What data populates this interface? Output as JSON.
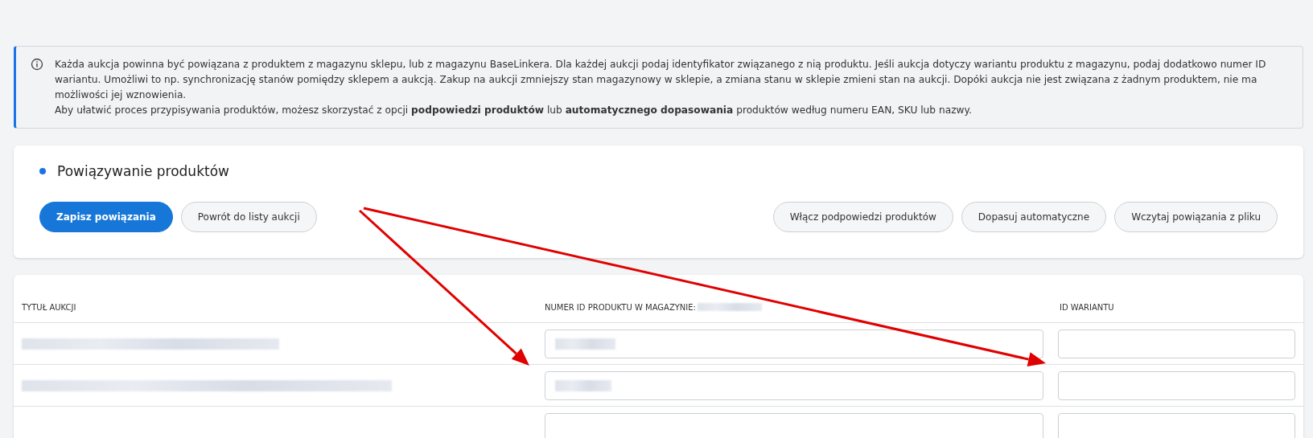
{
  "info": {
    "paragraphs": [
      "Każda aukcja powinna być powiązana z produktem z magazynu sklepu, lub z magazynu BaseLinkera. Dla każdej aukcji podaj identyfikator związanego z nią produktu. Jeśli aukcja dotyczy wariantu produktu z magazynu, podaj dodatkowo numer ID wariantu. Umożliwi to np. synchronizację stanów pomiędzy sklepem a aukcją. Zakup na aukcji zmniejszy stan magazynowy w sklepie, a zmiana stanu w sklepie zmieni stan na aukcji. Dopóki aukcja nie jest związana z żadnym produktem, nie ma możliwości jej wznowienia.",
      "Aby ułatwić proces przypisywania produktów, możesz skorzystać z opcji **podpowiedzi produktów** lub **automatycznego dopasowania** produktów według numeru EAN, SKU lub nazwy."
    ]
  },
  "section": {
    "title": "Powiązywanie produktów",
    "buttons_left": [
      {
        "label": "Zapisz powiązania",
        "kind": "primary"
      },
      {
        "label": "Powrót do listy aukcji",
        "kind": "secondary"
      }
    ],
    "buttons_right": [
      {
        "label": "Włącz podpowiedzi produktów",
        "kind": "secondary"
      },
      {
        "label": "Dopasuj automatyczne",
        "kind": "secondary"
      },
      {
        "label": "Wczytaj powiązania z pliku",
        "kind": "secondary"
      }
    ]
  },
  "table": {
    "columns": [
      "TYTUŁ AUKCJI",
      "NUMER ID PRODUKTU W MAGAZYNIE:",
      "ID WARIANTU"
    ],
    "column_2_blurred": true,
    "rows": [
      {
        "title_blurred": true,
        "product_id_blurred": true
      },
      {
        "title_blurred": true,
        "product_id_blurred": true
      },
      {
        "title_blurred": false,
        "product_id_blurred": false
      }
    ]
  },
  "annotations": [
    {
      "kind": "arrow"
    },
    {
      "kind": "arrow"
    }
  ]
}
